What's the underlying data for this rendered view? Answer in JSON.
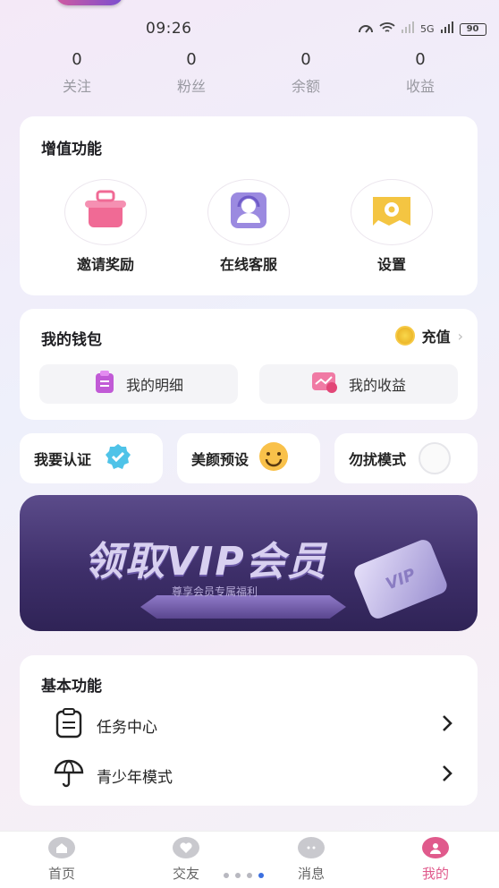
{
  "status": {
    "time": "09:26",
    "battery": "90",
    "network": "5G"
  },
  "stats": [
    {
      "value": "0",
      "label": "关注"
    },
    {
      "value": "0",
      "label": "粉丝"
    },
    {
      "value": "0",
      "label": "余额"
    },
    {
      "value": "0",
      "label": "收益"
    }
  ],
  "value_added": {
    "title": "增值功能",
    "items": [
      {
        "label": "邀请奖励",
        "icon": "gift-pot-icon"
      },
      {
        "label": "在线客服",
        "icon": "customer-service-icon"
      },
      {
        "label": "设置",
        "icon": "gear-icon"
      }
    ]
  },
  "wallet": {
    "title": "我的钱包",
    "recharge_label": "充值",
    "details_label": "我的明细",
    "earnings_label": "我的收益"
  },
  "quick": {
    "verify_label": "我要认证",
    "beauty_label": "美颜预设",
    "dnd_label": "勿扰模式",
    "dnd_on": false
  },
  "banner": {
    "title": "领取VIP会员",
    "subtitle": "尊享会员专属福利",
    "card_text": "VIP"
  },
  "basic": {
    "title": "基本功能",
    "items": [
      {
        "label": "任务中心",
        "icon": "task-list-icon"
      },
      {
        "label": "青少年模式",
        "icon": "umbrella-icon"
      }
    ]
  },
  "tabs": [
    {
      "label": "首页",
      "active": false
    },
    {
      "label": "交友",
      "active": false
    },
    {
      "label": "消息",
      "active": false
    },
    {
      "label": "我的",
      "active": true
    }
  ],
  "colors": {
    "accent": "#e0568a",
    "active_tab": "#e05a8c",
    "inactive_tab": "#666666"
  }
}
